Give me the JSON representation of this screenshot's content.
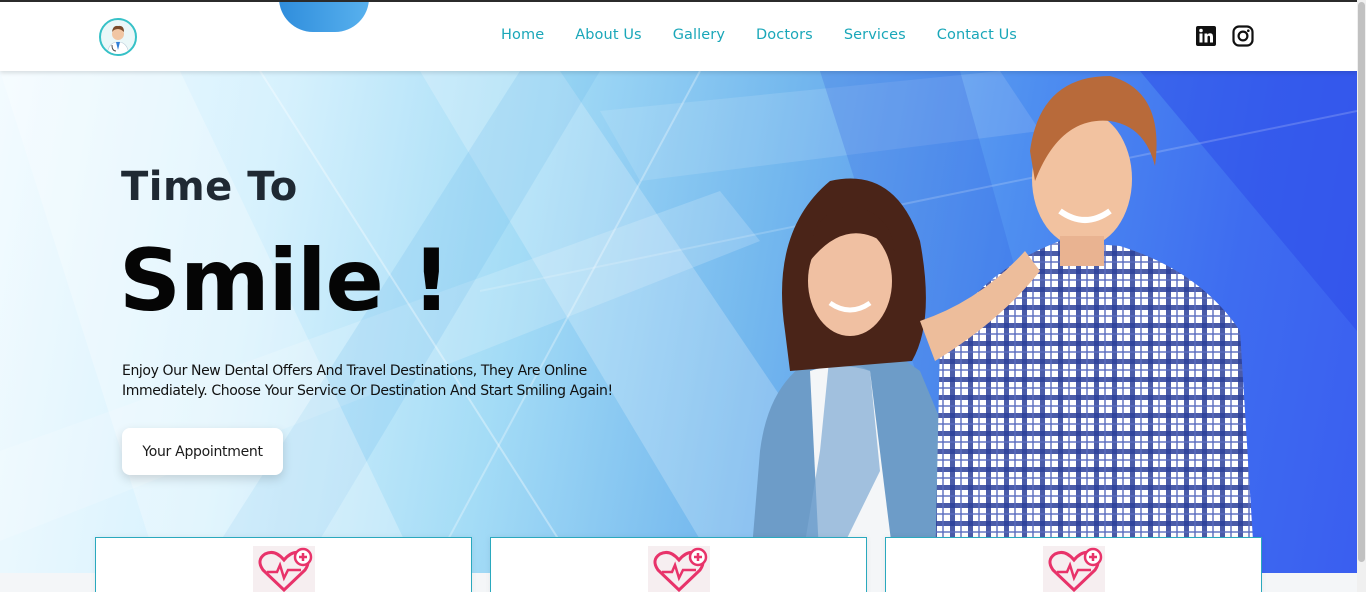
{
  "header": {
    "nav": [
      {
        "label": "Home"
      },
      {
        "label": "About Us"
      },
      {
        "label": "Gallery"
      },
      {
        "label": "Doctors"
      },
      {
        "label": "Services"
      },
      {
        "label": "Contact Us"
      }
    ],
    "logo_icon": "doctor-avatar-icon",
    "social": [
      "linkedin-icon",
      "instagram-icon"
    ]
  },
  "hero": {
    "title_small": "Time To",
    "title_big": "Smile !",
    "lead": "Enjoy Our New Dental Offers And Travel Destinations, They Are Online Immediately. Choose Your Service Or Destination And Start Smiling Again!",
    "button_label": "Your Appointment"
  },
  "cards": [
    {
      "icon": "heart-care-icon"
    },
    {
      "icon": "heart-care-icon"
    },
    {
      "icon": "heart-care-icon"
    }
  ],
  "colors": {
    "accent": "#1aa7b9",
    "card_icon": "#e8336a",
    "hero_blue": "#3a5ef0"
  }
}
